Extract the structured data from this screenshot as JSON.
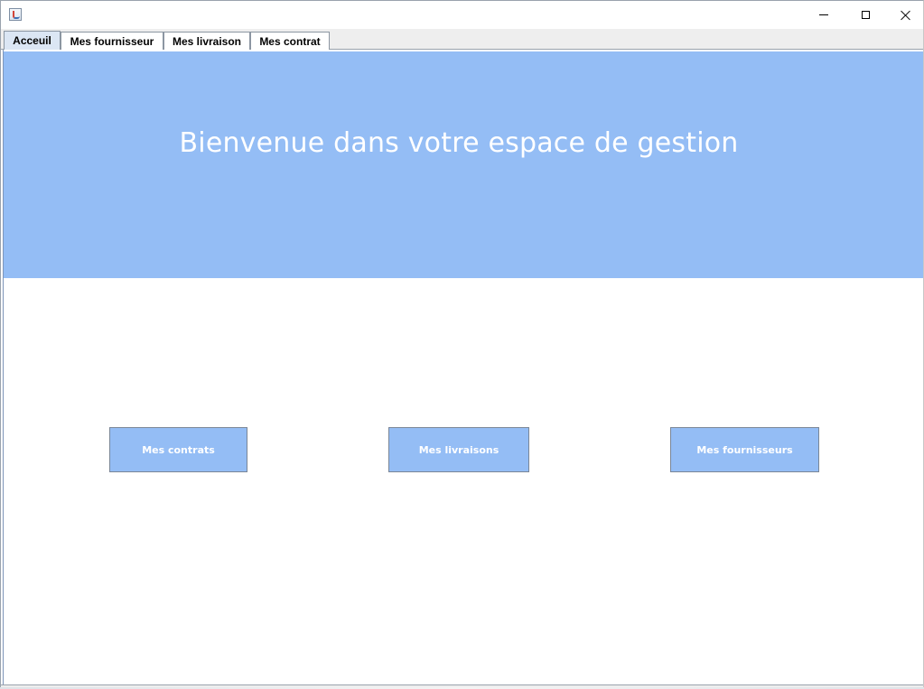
{
  "window": {
    "app_icon": "java-cup-icon",
    "controls": {
      "minimize_icon": "minimize-icon",
      "maximize_icon": "maximize-icon",
      "close_icon": "close-icon"
    }
  },
  "tabs": [
    {
      "label": "Acceuil",
      "active": true
    },
    {
      "label": "Mes fournisseur",
      "active": false
    },
    {
      "label": "Mes livraison",
      "active": false
    },
    {
      "label": "Mes contrat",
      "active": false
    }
  ],
  "banner": {
    "title": "Bienvenue dans votre espace de gestion",
    "color": "#94bdf5"
  },
  "buttons": [
    {
      "label": "Mes contrats"
    },
    {
      "label": "Mes livraisons"
    },
    {
      "label": "Mes fournisseurs"
    }
  ],
  "colors": {
    "accent": "#94bdf5",
    "button_text": "#ffffff",
    "active_tab": "#dbe6f4"
  }
}
